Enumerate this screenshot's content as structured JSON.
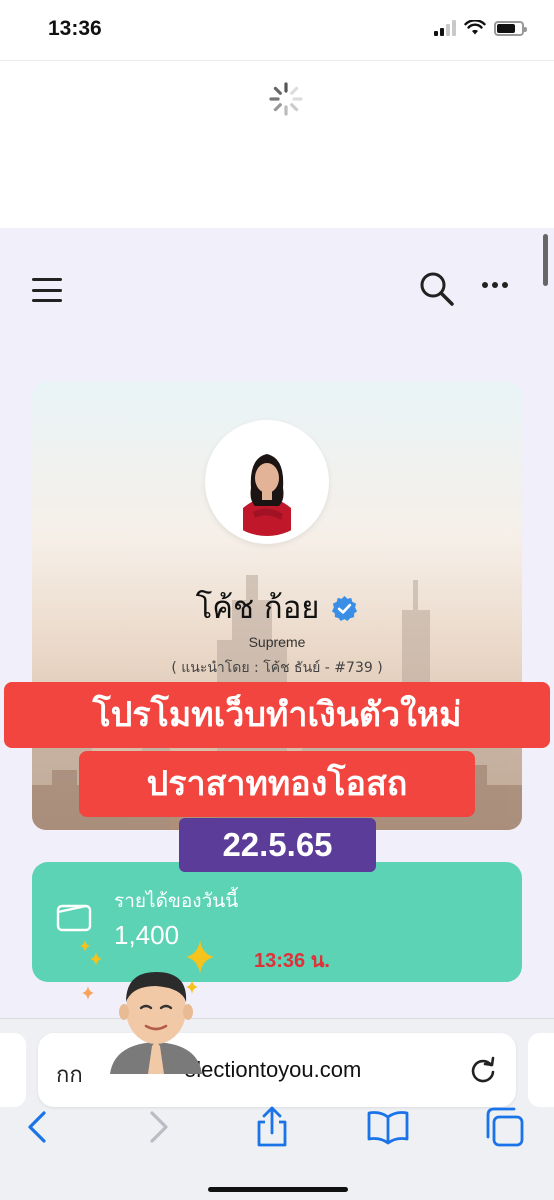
{
  "status_bar": {
    "time": "13:36"
  },
  "profile": {
    "name": "โค้ช ก้อย",
    "rank": "Supreme",
    "referral": "( แนะนำโดย : โค้ช ธันย์ - #739 )"
  },
  "overlay": {
    "banner_line1": "โปรโมทเว็บทำเงินตัวใหม่",
    "banner_line2": "ปราสาททองโอสถ",
    "date": "22.5.65"
  },
  "income": {
    "label": "รายได้ของวันนี้",
    "value": "1,400",
    "timestamp": "13:36 น."
  },
  "browser": {
    "reader_label": "กก",
    "url": "electiontoyou.com"
  },
  "colors": {
    "accent_green": "#5bd3b4",
    "banner_red": "#f2453f",
    "date_purple": "#5b3c98",
    "ios_blue": "#1a73e8"
  }
}
